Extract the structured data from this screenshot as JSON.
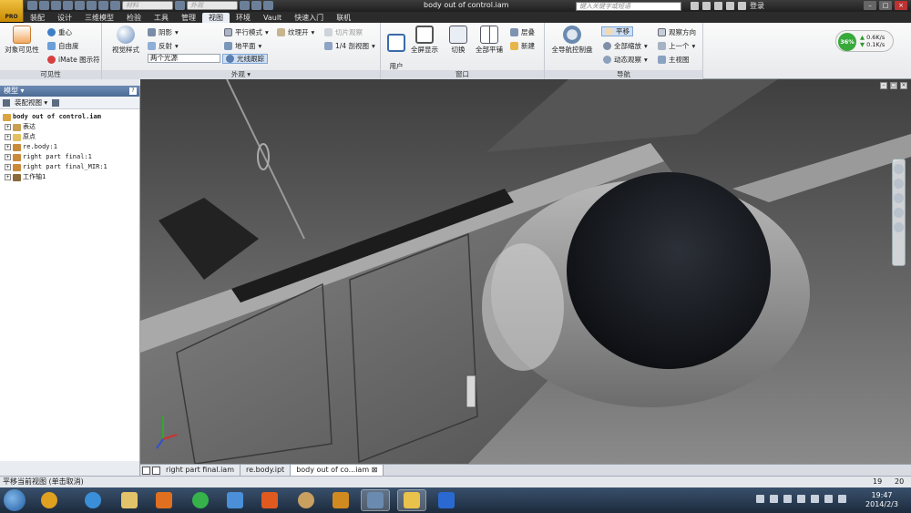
{
  "app": {
    "logo_text": "PRO",
    "doc_title": "body out of control.iam",
    "material_combo": "材料",
    "appearance_combo": "外观",
    "search_placeholder": "键入关键字或短语",
    "login": "登录"
  },
  "tabs": [
    "装配",
    "设计",
    "三维模型",
    "检验",
    "工具",
    "管理",
    "视图",
    "环境",
    "Vault",
    "快速入门",
    "联机"
  ],
  "active_tab": "视图",
  "ribbon": {
    "visibility": {
      "label": "可见性",
      "object_visibility": "对象可见性",
      "center_of_gravity": "重心",
      "dof": "自由度",
      "imate": "iMate 图示符"
    },
    "appearance": {
      "label": "外观",
      "visual_style": "视觉样式",
      "shadows": "阴影",
      "reflections": "反射",
      "lighting_combo": "两个光源",
      "parallel_mode": "平行模式",
      "ground_plane": "地平面",
      "texture_on": "纹理开",
      "ray_tracing": "光线跟踪",
      "slice_graphics": "切片观察",
      "quarter_section": "1/4 剖视图"
    },
    "windows": {
      "label": "窗口",
      "user_interface": "用户\n界面",
      "full_screen": "全屏显示",
      "switch": "切换",
      "tile_all": "全部平铺",
      "cascade": "层叠",
      "new": "新建"
    },
    "navigate": {
      "label": "导航",
      "full_nav_wheel": "全导航控制盘",
      "pan": "平移",
      "zoom_all": "全部缩放",
      "orbit": "动态观察",
      "view_face": "观察方向",
      "previous": "上一个",
      "home_view": "主视图"
    },
    "perf": {
      "percent": "36%",
      "up": "0.6K/s",
      "down": "0.1K/s"
    }
  },
  "browser": {
    "title": "模型",
    "help": "?",
    "view_combo": "装配视图",
    "tree": [
      {
        "label": "body out of control.iam",
        "root": true,
        "color": "#d9a441"
      },
      {
        "label": "表达",
        "color": "#c8a050"
      },
      {
        "label": "原点",
        "color": "#e0c060"
      },
      {
        "label": "re.body:1",
        "color": "#c98a3a"
      },
      {
        "label": "right part final:1",
        "color": "#c98a3a"
      },
      {
        "label": "right part final_MIR:1",
        "color": "#c98a3a"
      },
      {
        "label": "工作轴1",
        "color": "#8a6a3a"
      }
    ]
  },
  "doc_tabs": [
    "right part final.iam",
    "re.body.ipt",
    "body out of co...iam"
  ],
  "active_doc_tab": "body out of co...iam",
  "status": {
    "message": "平移当前视图 (单击取消)",
    "num1": "19",
    "num2": "20"
  },
  "taskbar": {
    "apps": [
      {
        "name": "chrome-icon",
        "color": "#e0a020"
      },
      {
        "name": "ie-icon",
        "color": "#3a8fd8"
      },
      {
        "name": "explorer-icon",
        "color": "#e3c36a"
      },
      {
        "name": "media-player-icon",
        "color": "#e07020"
      },
      {
        "name": "app360-icon",
        "color": "#35b34a"
      },
      {
        "name": "plane-icon",
        "color": "#4a8fd8"
      },
      {
        "name": "bird-icon",
        "color": "#e05a20"
      },
      {
        "name": "film-icon",
        "color": "#c9a060"
      },
      {
        "name": "game-icon",
        "color": "#d08a20"
      },
      {
        "name": "screenshot-icon",
        "color": "#6a8ab0"
      },
      {
        "name": "inventor-icon",
        "color": "#e8c24a"
      },
      {
        "name": "wps-icon",
        "color": "#2a6ad0"
      }
    ],
    "time": "19:47",
    "date": "2014/2/3"
  }
}
